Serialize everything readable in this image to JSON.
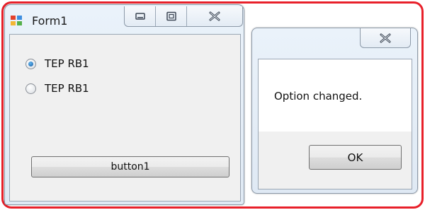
{
  "form1": {
    "title": "Form1",
    "icon": "winforms-app-icon",
    "controls": {
      "minimize_icon": "minimize-icon",
      "maximize_icon": "maximize-icon",
      "close_icon": "close-icon"
    },
    "radio_options": [
      {
        "label": "TEP RB1",
        "checked": true
      },
      {
        "label": "TEP RB1",
        "checked": false
      }
    ],
    "button_label": "button1"
  },
  "message_box": {
    "close_icon": "close-icon",
    "text": "Option changed.",
    "ok_label": "OK"
  },
  "colors": {
    "highlight_frame": "#e8202a",
    "window_frame": "#dfe9f4",
    "client_bg": "#f0f0f0"
  }
}
